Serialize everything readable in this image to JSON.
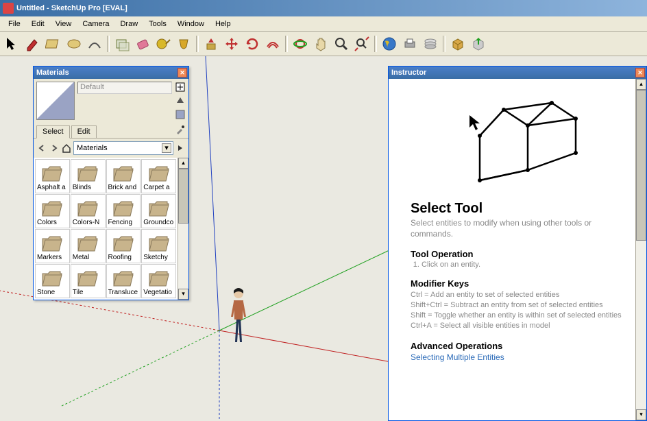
{
  "window": {
    "title": "Untitled - SketchUp Pro [EVAL]"
  },
  "menu": {
    "items": [
      "File",
      "Edit",
      "View",
      "Camera",
      "Draw",
      "Tools",
      "Window",
      "Help"
    ]
  },
  "toolbar": {
    "tools": [
      {
        "name": "select-tool",
        "glyph": "arrow"
      },
      {
        "name": "line-tool",
        "glyph": "pencil"
      },
      {
        "name": "rectangle-tool",
        "glyph": "rect"
      },
      {
        "name": "circle-tool",
        "glyph": "circle"
      },
      {
        "name": "arc-tool",
        "glyph": "arc"
      },
      {
        "name": "sep"
      },
      {
        "name": "make-component-tool",
        "glyph": "component"
      },
      {
        "name": "eraser-tool",
        "glyph": "eraser"
      },
      {
        "name": "tape-tool",
        "glyph": "tape"
      },
      {
        "name": "paint-tool",
        "glyph": "paint"
      },
      {
        "name": "sep"
      },
      {
        "name": "pushpull-tool",
        "glyph": "pushpull"
      },
      {
        "name": "move-tool",
        "glyph": "move"
      },
      {
        "name": "rotate-tool",
        "glyph": "rotate"
      },
      {
        "name": "offset-tool",
        "glyph": "offset"
      },
      {
        "name": "sep"
      },
      {
        "name": "orbit-tool",
        "glyph": "orbit"
      },
      {
        "name": "pan-tool",
        "glyph": "pan"
      },
      {
        "name": "zoom-tool",
        "glyph": "zoom"
      },
      {
        "name": "zoom-extents-tool",
        "glyph": "zoomext"
      },
      {
        "name": "sep"
      },
      {
        "name": "getmodels-tool",
        "glyph": "world"
      },
      {
        "name": "print-tool",
        "glyph": "print"
      },
      {
        "name": "layers-tool",
        "glyph": "layers"
      },
      {
        "name": "sep"
      },
      {
        "name": "warehouse-tool",
        "glyph": "box"
      },
      {
        "name": "share-tool",
        "glyph": "share"
      }
    ]
  },
  "materials": {
    "panel_title": "Materials",
    "current_name": "Default",
    "tabs": {
      "select": "Select",
      "edit": "Edit"
    },
    "combo_value": "Materials",
    "folders": [
      "Asphalt a",
      "Blinds",
      "Brick and",
      "Carpet a",
      "Colors",
      "Colors-N",
      "Fencing",
      "Groundco",
      "Markers",
      "Metal",
      "Roofing",
      "Sketchy",
      "Stone",
      "Tile",
      "Transluce",
      "Vegetatio"
    ]
  },
  "instructor": {
    "panel_title": "Instructor",
    "tool_title": "Select Tool",
    "tool_desc": "Select entities to modify when using other tools or commands.",
    "op_title": "Tool Operation",
    "op_step1": "Click on an entity.",
    "mod_title": "Modifier Keys",
    "mod_ctrl": "Ctrl = Add an entity to set of selected entities",
    "mod_shiftctrl": "Shift+Ctrl = Subtract an entity from set of selected entities",
    "mod_shift": "Shift = Toggle whether an entity is within set of selected entities",
    "mod_ctrla": "Ctrl+A = Select all visible entities in model",
    "adv_title": "Advanced Operations",
    "adv_link": "Selecting Multiple Entities"
  }
}
